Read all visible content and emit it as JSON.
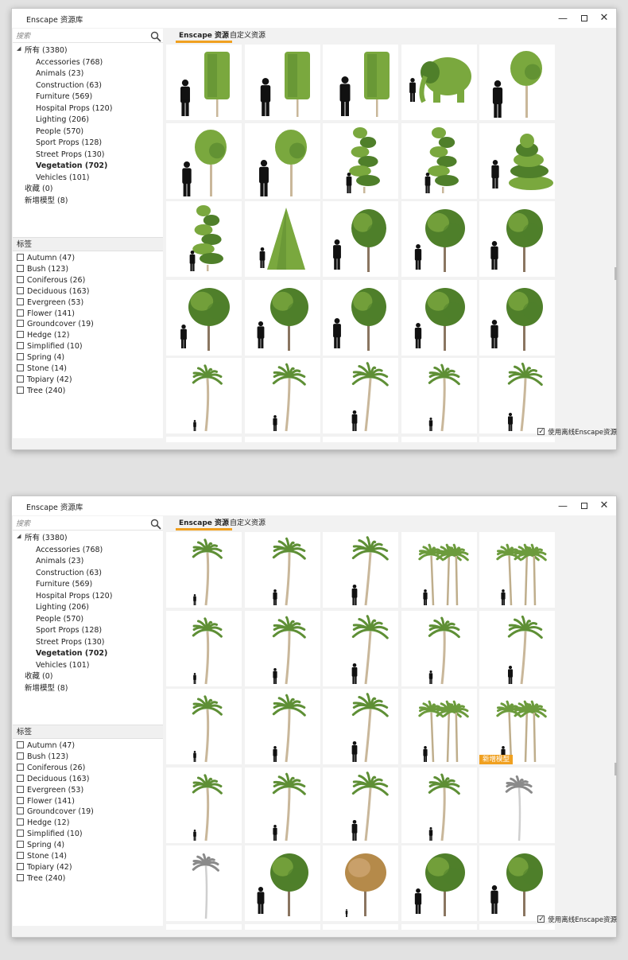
{
  "windows": [
    {
      "title": "Enscape 资源库",
      "search_placeholder": "搜索",
      "tree": {
        "root": "所有 (3380)",
        "children": [
          "Accessories (768)",
          "Animals (23)",
          "Construction (63)",
          "Furniture (569)",
          "Hospital Props (120)",
          "Lighting (206)",
          "People (570)",
          "Sport Props (128)",
          "Street Props (130)",
          "Vegetation (702)",
          "Vehicles (101)"
        ],
        "selected": "Vegetation (702)",
        "favorites": "收藏 (0)",
        "new_models": "新增模型 (8)"
      },
      "tags_header": "标签",
      "tags": [
        "Autumn (47)",
        "Bush (123)",
        "Coniferous (26)",
        "Deciduous (163)",
        "Evergreen (53)",
        "Flower (141)",
        "Groundcover (19)",
        "Hedge (12)",
        "Simplified (10)",
        "Spring (4)",
        "Stone (14)",
        "Topiary (42)",
        "Tree (240)"
      ],
      "tabs": [
        "Enscape 资源",
        "自定义资源"
      ],
      "active_tab": "Enscape 资源",
      "offline_label": "使用离线Enscape资源",
      "offline_checked": true,
      "tiles": [
        "topiary-box",
        "topiary-box",
        "topiary-box",
        "topiary-elephant",
        "topiary-ball",
        "topiary-ball",
        "topiary-ball",
        "topiary-spiral",
        "topiary-spiral",
        "topiary-cake",
        "topiary-spiral",
        "topiary-cone",
        "tree",
        "tree",
        "tree",
        "tree",
        "tree",
        "tree",
        "tree",
        "tree",
        "palm",
        "palm",
        "palm",
        "palm",
        "palm"
      ],
      "badge": ""
    },
    {
      "title": "Enscape 资源库",
      "search_placeholder": "搜索",
      "tree": {
        "root": "所有 (3380)",
        "children": [
          "Accessories (768)",
          "Animals (23)",
          "Construction (63)",
          "Furniture (569)",
          "Hospital Props (120)",
          "Lighting (206)",
          "People (570)",
          "Sport Props (128)",
          "Street Props (130)",
          "Vegetation (702)",
          "Vehicles (101)"
        ],
        "selected": "Vegetation (702)",
        "favorites": "收藏 (0)",
        "new_models": "新增模型 (8)"
      },
      "tags_header": "标签",
      "tags": [
        "Autumn (47)",
        "Bush (123)",
        "Coniferous (26)",
        "Deciduous (163)",
        "Evergreen (53)",
        "Flower (141)",
        "Groundcover (19)",
        "Hedge (12)",
        "Simplified (10)",
        "Spring (4)",
        "Stone (14)",
        "Topiary (42)",
        "Tree (240)"
      ],
      "tabs": [
        "Enscape 资源",
        "自定义资源"
      ],
      "active_tab": "Enscape 资源",
      "offline_label": "使用离线Enscape资源",
      "offline_checked": true,
      "tiles": [
        "palm",
        "palm",
        "palm",
        "banana",
        "banana",
        "palm",
        "palm",
        "palm",
        "palm",
        "palm",
        "palm",
        "palm",
        "palm",
        "banana",
        "banana",
        "palm",
        "palm",
        "palm",
        "palm",
        "palm-grey",
        "palm-grey",
        "tree",
        "tree-autumn",
        "tree",
        "tree"
      ],
      "badge": "新增模型"
    }
  ],
  "colors": {
    "foliage": "#7aa83e",
    "foliage_dark": "#4f7f2a",
    "autumn": "#b58a4a",
    "trunk": "#c9b79a",
    "silhouette": "#111111",
    "accent": "#f0a020"
  }
}
